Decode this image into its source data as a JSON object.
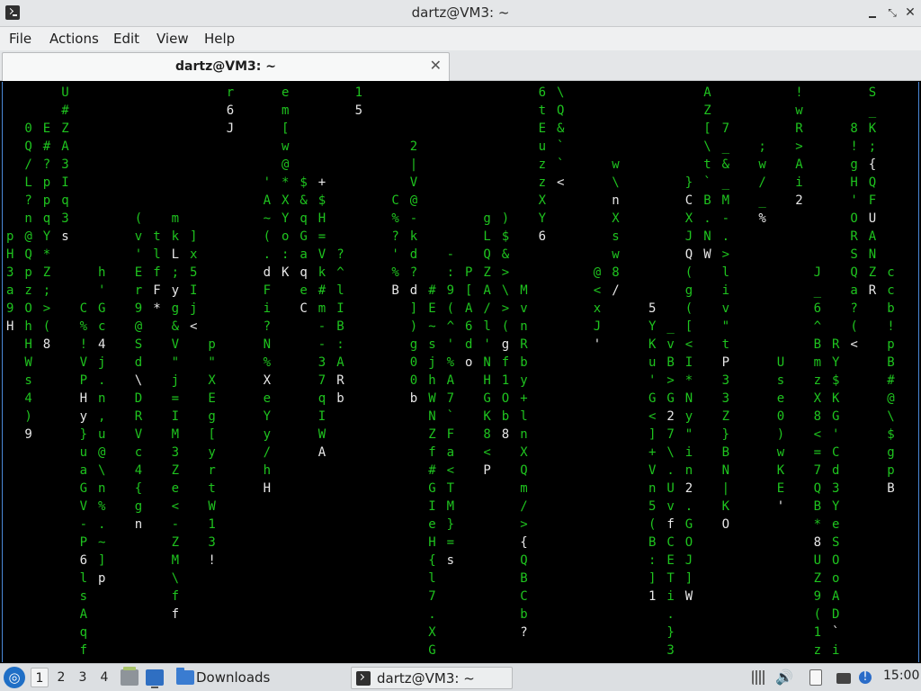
{
  "window": {
    "title": "dartz@VM3: ~",
    "controls": {
      "minimize": "–",
      "maximize": "⤡",
      "close": "✕"
    }
  },
  "menu": [
    "File",
    "Actions",
    "Edit",
    "View",
    "Help"
  ],
  "tab": {
    "label": "dartz@VM3: ~",
    "close": "✕"
  },
  "terminal": {
    "program": "cmatrix-style falling characters",
    "colors": {
      "background": "#000000",
      "glyph": "#1fc41f",
      "head": "#e8e8e8"
    }
  },
  "taskbar": {
    "workspaces": [
      "1",
      "2",
      "3",
      "4"
    ],
    "active_workspace": "1",
    "tasks": [
      {
        "label": "Downloads",
        "icon": "folder-icon"
      },
      {
        "label": "dartz@VM3: ~",
        "icon": "terminal-icon"
      }
    ],
    "clock": "15:00"
  }
}
